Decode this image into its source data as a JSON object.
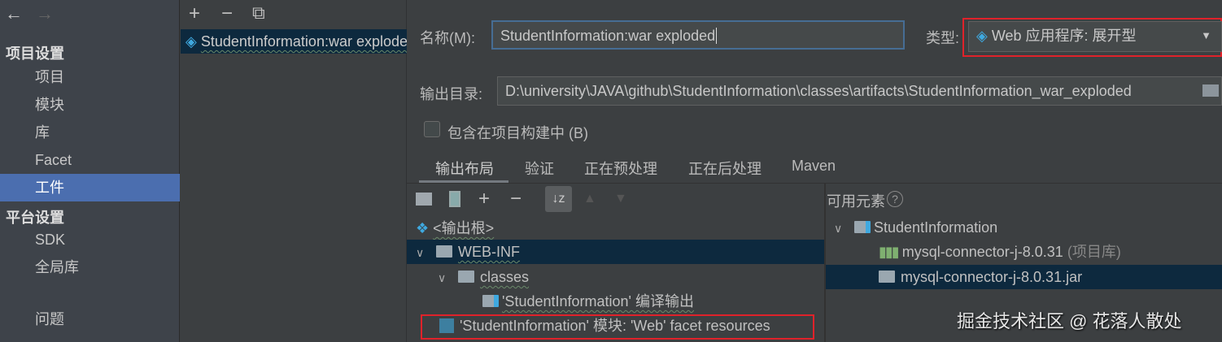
{
  "nav": {
    "back": "←",
    "forward": "→"
  },
  "sidebar": {
    "project_settings": "项目设置",
    "items": [
      "项目",
      "模块",
      "库",
      "Facet",
      "工件"
    ],
    "platform_settings": "平台设置",
    "platform_items": [
      "SDK",
      "全局库"
    ],
    "problems": "问题",
    "selected": "工件"
  },
  "artifacts": {
    "add": "+",
    "remove": "−",
    "copy": "⧉",
    "items": [
      "StudentInformation:war exploded"
    ]
  },
  "form": {
    "name_label": "名称(M):",
    "name_value": "StudentInformation:war exploded",
    "type_label": "类型:",
    "type_value": "Web 应用程序: 展开型",
    "output_label": "输出目录:",
    "output_value": "D:\\university\\JAVA\\github\\StudentInformation\\classes\\artifacts\\StudentInformation_war_exploded",
    "include_label": "包含在项目构建中 (B)",
    "include_checked": false
  },
  "tabs": [
    "输出布局",
    "验证",
    "正在预处理",
    "正在后处理",
    "Maven"
  ],
  "active_tab": "输出布局",
  "layout_tree": [
    "<输出根>",
    "WEB-INF",
    "classes",
    "'StudentInformation' 编译输出",
    "'StudentInformation' 模块: 'Web' facet resources"
  ],
  "available": {
    "title": "可用元素",
    "help": "?",
    "items": [
      "StudentInformation",
      "mysql-connector-j-8.0.31",
      "(项目库)",
      "mysql-connector-j-8.0.31.jar"
    ]
  },
  "watermark": "掘金技术社区 @ 花落人散处",
  "colors": {
    "selection": "#0d293e",
    "sidebar_selected": "#4b6eaf",
    "highlight": "#e0222a"
  }
}
